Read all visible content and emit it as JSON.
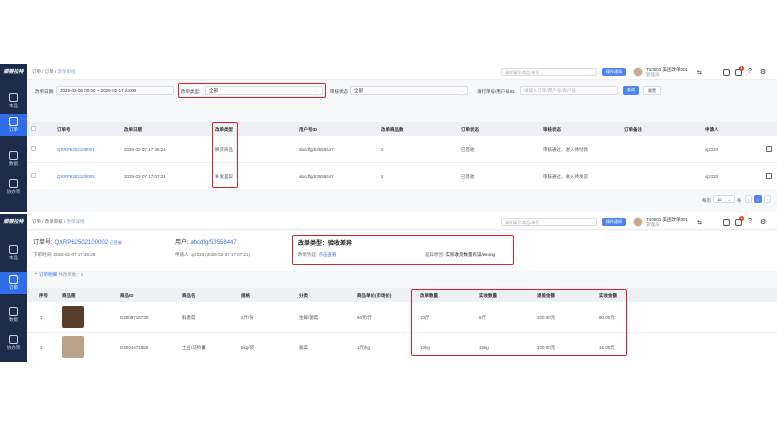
{
  "sidebar": {
    "logo": "顺银拉特",
    "items": [
      {
        "label": "本品"
      },
      {
        "label": "订单"
      },
      {
        "label": "数据"
      },
      {
        "label": "协办项"
      }
    ]
  },
  "header": {
    "breadcrumb": [
      "订单",
      "订单",
      "改单审核"
    ],
    "search_placeholder": "请仅填写/商品/单号",
    "action_button": "操作通知",
    "user_name": "T10001 美团改单001",
    "user_sub": "管理员",
    "badge_count": "1"
  },
  "filters": {
    "date_label": "改单日期:",
    "date_value": "2025-02-06 00:00 ~ 2025-02-17 24:00",
    "type_label": "改单类型:",
    "type_value": "全部",
    "audit_label": "审核状态:",
    "audit_value": "全部",
    "keyword_label": "请行单号/用户号ID:",
    "keyword_placeholder": "请输入订单/用户号/商户号",
    "search_button": "查询",
    "reset_button": "重置"
  },
  "list": {
    "columns": [
      "订单号",
      "改单日期",
      "改单类型",
      "用户号ID",
      "改单商品数",
      "订单状态",
      "审核状态",
      "订单备注",
      "申请人"
    ],
    "rows": [
      {
        "order": "QXRP6302100001",
        "date": "2025-02-07 17:36:24",
        "type": "换货商品",
        "user": "abcdfg/53558447",
        "count": "2",
        "status": "已签收",
        "audit": "审核通过，进入待付款",
        "remark": "",
        "applicant": "xjz333"
      },
      {
        "order": "QXRP6302100002",
        "date": "2025-02-07 17:07:21",
        "type": "补发差异",
        "user": "abcdfg/53558447",
        "count": "2",
        "status": "已签收",
        "audit": "审核通过，进入待发货",
        "remark": "",
        "applicant": "xjz333"
      }
    ],
    "pagination": {
      "page_size_label": "每页",
      "page_size": "10",
      "unit": "条",
      "current": "1"
    }
  },
  "detail": {
    "breadcrumb": [
      "订单",
      "改单审核",
      "改单详情"
    ],
    "order_label": "订单号:",
    "order_no": "QXRP62502100002",
    "order_status": "已签收",
    "time_label": "下单时间:",
    "time_value": "2025-02-07 17:36:25",
    "user_label": "用户:",
    "user_value": "abcdfg/53558447",
    "applicant_label": "申请人:",
    "applicant_value": "xjz333 (2025-02-07 17:07:21)",
    "type_title": "改单类型：验收差异",
    "proof_label": "改单凭证:",
    "proof_link": "点击查看",
    "reason_label": "差异原因:",
    "reason_value": "实际收货数量有误/wrong",
    "section_title": "订单明细",
    "section_sub": "共改单数：2",
    "columns": [
      "序号",
      "商品图",
      "商品ID",
      "商品名",
      "规格",
      "分类",
      "商品单价(市场价)",
      "改单数量",
      "实收数量",
      "退差金额",
      "实收金额"
    ],
    "rows": [
      {
        "idx": "1",
        "sku": "D3009716730",
        "name": "鲜香菇",
        "spec": "2斤/份",
        "cat": "生鲜/菌菇",
        "price": "50元/斤",
        "qty": "10斤",
        "recv": "8斤",
        "diff": "100.00元",
        "actual": "80.00元"
      },
      {
        "idx": "2",
        "sku": "D3004471958",
        "name": "土豆/马铃薯",
        "spec": "5kg/袋",
        "cat": "蔬菜",
        "price": "1元/kg",
        "qty": "10kg",
        "recv": "15kg",
        "diff": "100.00元",
        "actual": "15.00元"
      }
    ]
  },
  "colors": {
    "sidebar": "#1c2b4a",
    "active": "#2f6ee8",
    "highlight": "#d6262b",
    "link": "#3f74e0"
  }
}
